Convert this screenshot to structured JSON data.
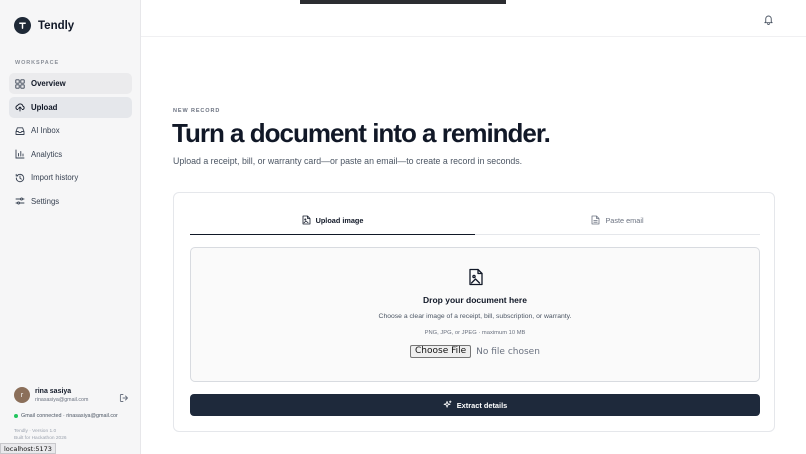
{
  "app": {
    "name": "Tendly"
  },
  "sidebar": {
    "section_label": "WORKSPACE",
    "items": [
      {
        "label": "Overview",
        "icon": "grid-icon"
      },
      {
        "label": "Upload",
        "icon": "upload-cloud-icon"
      },
      {
        "label": "AI Inbox",
        "icon": "inbox-icon"
      },
      {
        "label": "Analytics",
        "icon": "bar-chart-icon"
      },
      {
        "label": "Import history",
        "icon": "history-icon"
      },
      {
        "label": "Settings",
        "icon": "sliders-icon"
      }
    ],
    "active_item": "Upload",
    "user": {
      "initial": "r",
      "name": "rina sasiya",
      "email": "rinasasiya@gmail.com"
    },
    "gmail_status": "Gmail connected · rinasasiya@gmail.cor",
    "version": "Tendly · Version 1.0",
    "built": "Built for Hackathon 2026"
  },
  "statusbar": {
    "text": "localhost:5173"
  },
  "page": {
    "eyebrow": "NEW RECORD",
    "headline": "Turn a document into a reminder.",
    "subhead": "Upload a receipt, bill, or warranty card—or paste an email—to create a record in seconds."
  },
  "tabs": [
    {
      "label": "Upload image",
      "icon": "image-file-icon",
      "active": true
    },
    {
      "label": "Paste email",
      "icon": "text-file-icon",
      "active": false
    }
  ],
  "dropzone": {
    "title": "Drop your document here",
    "description": "Choose a clear image of a receipt, bill, subscription, or warranty.",
    "formats": "PNG, JPG, or JPEG · maximum 10 MB",
    "choose_label": "Choose File",
    "file_status": "No file chosen"
  },
  "extract_button": {
    "label": "Extract details"
  },
  "colors": {
    "accent": "#1e293b",
    "status_ok": "#22c55e"
  }
}
